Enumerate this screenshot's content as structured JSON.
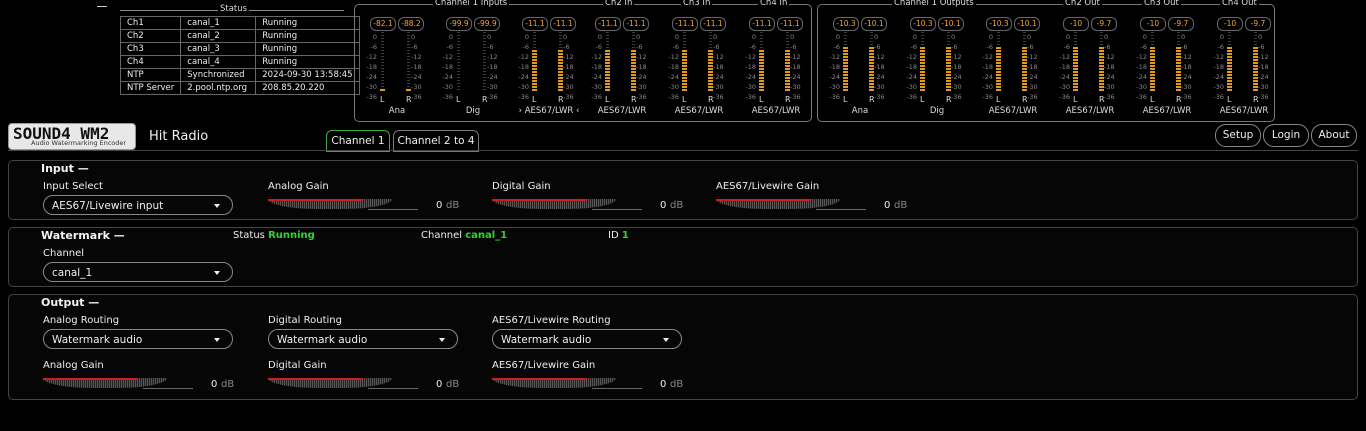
{
  "status": {
    "legend": "Status",
    "rows": [
      [
        "Ch1",
        "canal_1",
        "Running"
      ],
      [
        "Ch2",
        "canal_2",
        "Running"
      ],
      [
        "Ch3",
        "canal_3",
        "Running"
      ],
      [
        "Ch4",
        "canal_4",
        "Running"
      ],
      [
        "NTP",
        "Synchronized",
        "2024-09-30 13:58:45"
      ],
      [
        "NTP Server",
        "2.pool.ntp.org",
        "208.85.20.220"
      ]
    ]
  },
  "meters": {
    "inputs": {
      "legend": "Channel 1 Inputs",
      "groups": [
        {
          "label": "Ana",
          "peaks": [
            "-82.1",
            "-88.2"
          ],
          "levels": [
            0.03,
            0.03
          ]
        },
        {
          "label": "Dig",
          "peaks": [
            "-99.9",
            "-99.9"
          ],
          "levels": [
            0.02,
            0.02
          ]
        },
        {
          "label": "› AES67/LWR ‹",
          "peaks": [
            "-11.1",
            "-11.1"
          ],
          "levels": [
            0.72,
            0.72
          ]
        }
      ]
    },
    "ch2in": {
      "legend": "Ch2 In",
      "label": "AES67/LWR",
      "peaks": [
        "-11.1",
        "-11.1"
      ],
      "levels": [
        0.72,
        0.72
      ]
    },
    "ch3in": {
      "legend": "Ch3 In",
      "label": "AES67/LWR",
      "peaks": [
        "-11.1",
        "-11.1"
      ],
      "levels": [
        0.72,
        0.72
      ]
    },
    "ch4in": {
      "legend": "Ch4 In",
      "label": "AES67/LWR",
      "peaks": [
        "-11.1",
        "-11.1"
      ],
      "levels": [
        0.72,
        0.72
      ]
    },
    "outputs": {
      "legend": "Channel 1 Outputs",
      "groups": [
        {
          "label": "Ana",
          "peaks": [
            "-10.3",
            "-10.1"
          ],
          "levels": [
            0.74,
            0.74
          ]
        },
        {
          "label": "Dig",
          "peaks": [
            "-10.3",
            "-10.1"
          ],
          "levels": [
            0.74,
            0.74
          ]
        },
        {
          "label": "AES67/LWR",
          "peaks": [
            "-10.3",
            "-10.1"
          ],
          "levels": [
            0.74,
            0.74
          ]
        }
      ]
    },
    "ch2out": {
      "legend": "Ch2 Out",
      "label": "AES67/LWR",
      "peaks": [
        "-10",
        "-9.7"
      ],
      "levels": [
        0.75,
        0.76
      ]
    },
    "ch3out": {
      "legend": "Ch3 Out",
      "label": "AES67/LWR",
      "peaks": [
        "-10",
        "-9.7"
      ],
      "levels": [
        0.75,
        0.76
      ]
    },
    "ch4out": {
      "legend": "Ch4 Out",
      "label": "AES67/LWR",
      "peaks": [
        "-10",
        "-9.7"
      ],
      "levels": [
        0.75,
        0.76
      ]
    },
    "scale": [
      "0",
      "-6",
      "-12",
      "-18",
      "-24",
      "-30",
      "-36"
    ],
    "ch_left": "L",
    "ch_right": "R"
  },
  "header": {
    "logo_main": "SOUND4 WM2",
    "logo_sub": "Audio Watermarking Encoder",
    "station": "Hit Radio",
    "tabs": [
      "Channel 1",
      "Channel 2 to 4"
    ],
    "buttons": [
      "Setup",
      "Login",
      "About"
    ]
  },
  "input": {
    "title": "Input",
    "select_label": "Input Select",
    "select_value": "AES67/Livewire input",
    "gains": [
      {
        "label": "Analog Gain",
        "value": "0",
        "unit": "dB"
      },
      {
        "label": "Digital Gain",
        "value": "0",
        "unit": "dB"
      },
      {
        "label": "AES67/Livewire Gain",
        "value": "0",
        "unit": "dB"
      }
    ]
  },
  "watermark": {
    "title": "Watermark",
    "status_label": "Status",
    "status_value": "Running",
    "channel_label": "Channel",
    "channel_value": "canal_1",
    "id_label": "ID",
    "id_value": "1",
    "select_label": "Channel",
    "select_value": "canal_1"
  },
  "output": {
    "title": "Output",
    "routings": [
      {
        "label": "Analog Routing",
        "value": "Watermark audio"
      },
      {
        "label": "Digital Routing",
        "value": "Watermark audio"
      },
      {
        "label": "AES67/Livewire Routing",
        "value": "Watermark audio"
      }
    ],
    "gains": [
      {
        "label": "Analog Gain",
        "value": "0",
        "unit": "dB"
      },
      {
        "label": "Digital Gain",
        "value": "0",
        "unit": "dB"
      },
      {
        "label": "AES67/Livewire Gain",
        "value": "0",
        "unit": "dB"
      }
    ]
  },
  "colors": {
    "accent_green": "#2ed52e",
    "peak_orange": "#f3a33a",
    "meter_bar": "#e39a1c",
    "knob_red": "#c81e1e"
  }
}
